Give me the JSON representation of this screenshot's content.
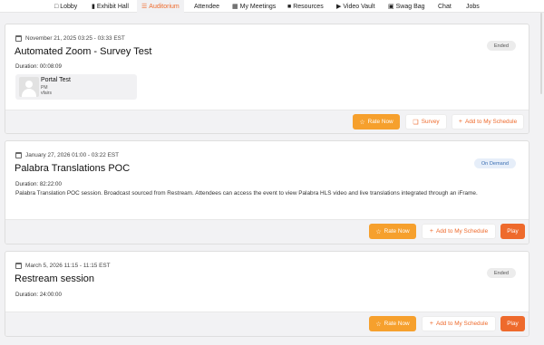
{
  "nav": {
    "items": [
      {
        "label": "Lobby",
        "icon": "lobby-icon"
      },
      {
        "label": "Exhibit Hall",
        "icon": "exhibit-hall-icon"
      },
      {
        "label": "Auditorium",
        "icon": "auditorium-icon",
        "active": true
      },
      {
        "label": "Attendee"
      },
      {
        "label": "My Meetings",
        "icon": "calendar-icon"
      },
      {
        "label": "Resources",
        "icon": "resources-icon"
      },
      {
        "label": "Video Vault",
        "icon": "video-icon"
      },
      {
        "label": "Swag Bag",
        "icon": "bag-icon"
      },
      {
        "label": "Chat"
      },
      {
        "label": "Jobs"
      }
    ]
  },
  "colors": {
    "accent": "#ee6a2c",
    "rate": "#f6a02d",
    "ondemand_bg": "#e6eef9",
    "ondemand_text": "#3b6fb3"
  },
  "sessions": [
    {
      "date": "November 21, 2025 03:25 - 03:33 EST",
      "title": "Automated Zoom - Survey Test",
      "duration": "Duration: 00:08:09",
      "status": "Ended",
      "speaker": {
        "name": "Portal Test",
        "role": "PM",
        "org": "vfairs"
      },
      "buttons": {
        "rate": "Rate Now",
        "survey": "Survey",
        "schedule": "Add to My Schedule"
      }
    },
    {
      "date": "January 27, 2026 01:00 - 03:22 EST",
      "title": "Palabra Translations POC",
      "duration": "Duration: 82:22:00",
      "status": "On Demand",
      "description": "Palabra Translation POC session. Broadcast sourced from Restream. Attendees can access the event to view Palabra HLS video and live translations integrated through an iFrame.",
      "buttons": {
        "rate": "Rate Now",
        "schedule": "Add to My Schedule",
        "play": "Play"
      }
    },
    {
      "date": "March 5, 2026 11:15 - 11:15 EST",
      "title": "Restream session",
      "duration": "Duration: 24:00:00",
      "status": "Ended",
      "buttons": {
        "rate": "Rate Now",
        "schedule": "Add to My Schedule",
        "play": "Play"
      }
    }
  ]
}
